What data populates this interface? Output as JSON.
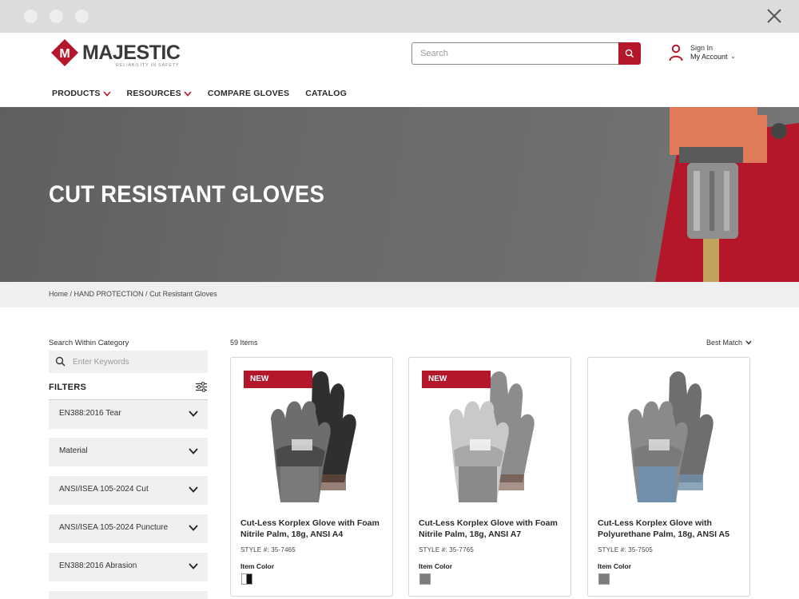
{
  "window": {
    "close_icon": "close-x-icon"
  },
  "brand": {
    "name": "MAJESTIC",
    "tagline": "RELIABILITY IN SAFETY",
    "letter": "M",
    "color": "#b5172a"
  },
  "search": {
    "placeholder": "Search",
    "value": ""
  },
  "account": {
    "signin": "Sign In",
    "my_account": "My Account"
  },
  "nav": [
    {
      "label": "PRODUCTS",
      "has_dropdown": true
    },
    {
      "label": "RESOURCES",
      "has_dropdown": true
    },
    {
      "label": "COMPARE GLOVES",
      "has_dropdown": false
    },
    {
      "label": "CATALOG",
      "has_dropdown": false
    }
  ],
  "hero": {
    "title": "CUT RESISTANT GLOVES"
  },
  "breadcrumb": {
    "home": "Home",
    "sep": " / ",
    "parent": "HAND PROTECTION",
    "current": "Cut Resistant Gloves"
  },
  "sidebar": {
    "search_label": "Search Within Category",
    "search_placeholder": "Enter Keywords",
    "filters_title": "FILTERS",
    "facets": [
      "EN388:2016 Tear",
      "Material",
      "ANSI/ISEA 105-2024 Cut",
      "ANSI/ISEA 105-2024 Puncture",
      "EN388:2016 Abrasion"
    ]
  },
  "results": {
    "count": "59 Items",
    "sort": "Best Match",
    "products": [
      {
        "badge": "NEW",
        "name": "Cut-Less Korplex Glove with Foam Nitrile Palm, 18g, ANSI A4",
        "style": "STYLE #: 35-7465",
        "color_label": "Item Color",
        "palm": "#2f2f2f",
        "shell": "#6d6d6d",
        "cuff": "#7a7a7a"
      },
      {
        "badge": "NEW",
        "name": "Cut-Less Korplex Glove with Foam Nitrile Palm, 18g, ANSI A7",
        "style": "STYLE #: 35-7765",
        "color_label": "Item Color",
        "palm": "#8c8c8c",
        "shell": "#c9c9c9",
        "cuff": "#8a8a8a"
      },
      {
        "badge": "",
        "name": "Cut-Less Korplex Glove with Polyurethane Palm, 18g, ANSI A5",
        "style": "STYLE #: 35-7505",
        "color_label": "Item Color",
        "palm": "#6e6e6e",
        "shell": "#8a8a8a",
        "cuff": "#6f8faa"
      }
    ]
  }
}
